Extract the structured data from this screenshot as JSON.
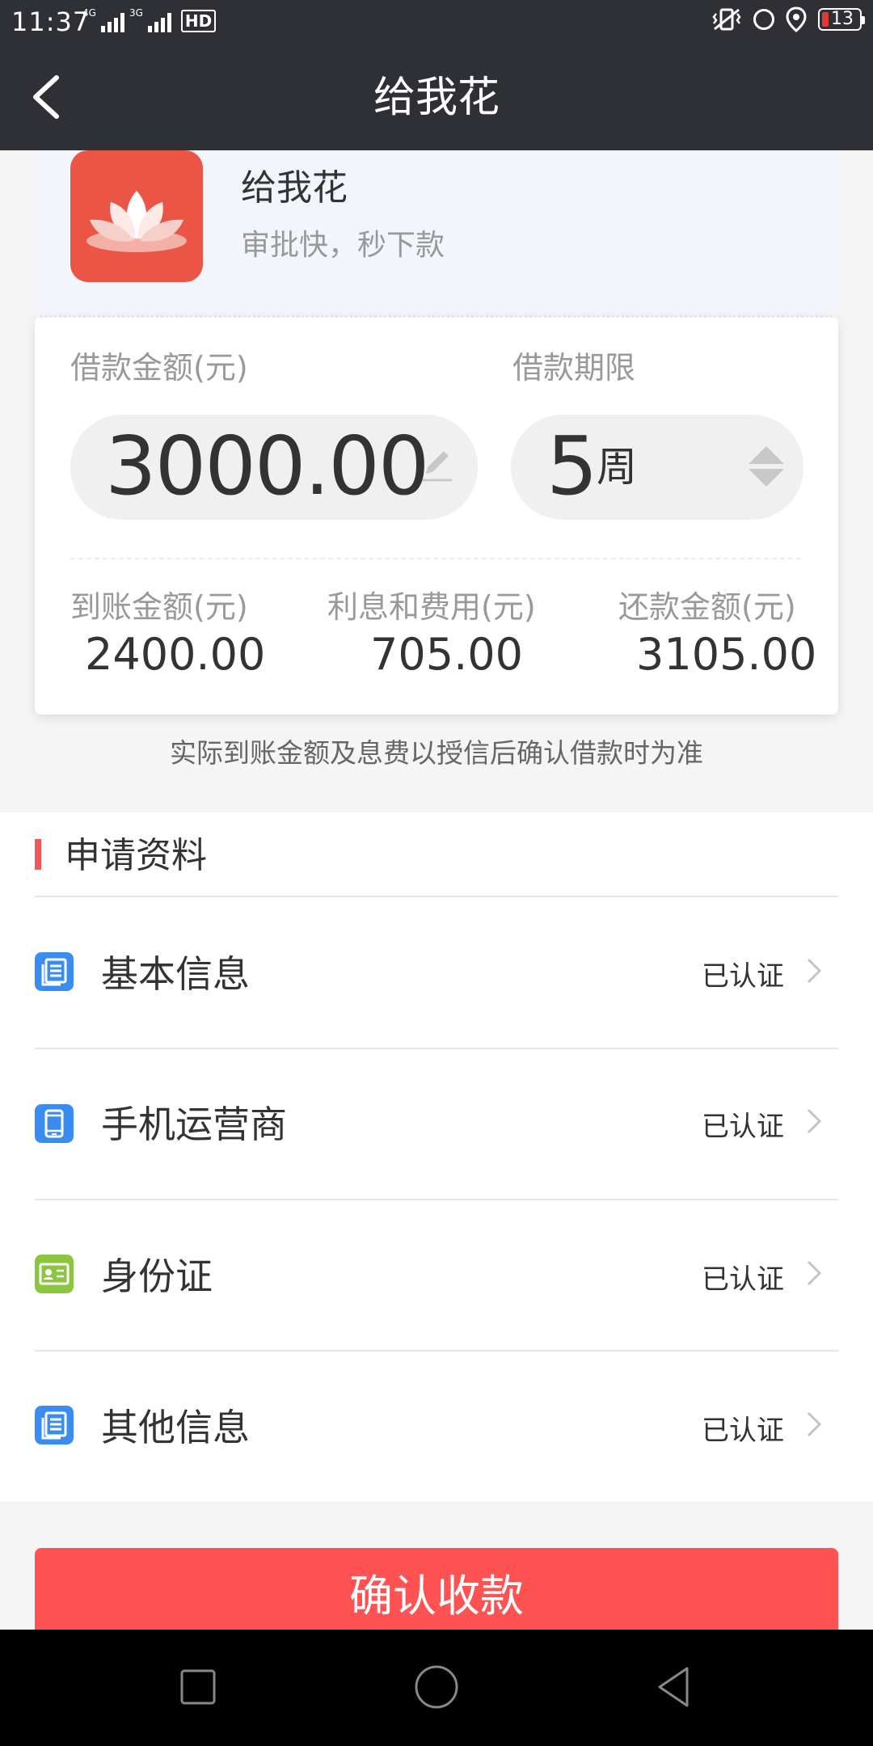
{
  "status_bar": {
    "time": "11:37",
    "net1": "4G",
    "net2": "3G",
    "hd": "HD",
    "battery": "13"
  },
  "header": {
    "title": "给我花"
  },
  "app": {
    "name": "给我花",
    "slogan": "审批快，秒下款"
  },
  "loan": {
    "amount_label": "借款金额(元)",
    "amount_value": "3000.00",
    "term_label": "借款期限",
    "term_number": "5",
    "term_unit": "周",
    "received_label": "到账金额(元)",
    "received_value": "2400.00",
    "fees_label": "利息和费用(元)",
    "fees_value": "705.00",
    "repay_label": "还款金额(元)",
    "repay_value": "3105.00",
    "notice": "实际到账金额及息费以授信后确认借款时为准"
  },
  "materials": {
    "title": "申请资料",
    "items": [
      {
        "label": "基本信息",
        "status": "已认证",
        "icon": "document-icon",
        "color": "#3b8cf0"
      },
      {
        "label": "手机运营商",
        "status": "已认证",
        "icon": "phone-icon",
        "color": "#3b8cf0"
      },
      {
        "label": "身份证",
        "status": "已认证",
        "icon": "id-card-icon",
        "color": "#8cc63f"
      },
      {
        "label": "其他信息",
        "status": "已认证",
        "icon": "document-icon",
        "color": "#3b8cf0"
      }
    ]
  },
  "confirm_button": "确认收款",
  "colors": {
    "header_bg": "#2e3035",
    "accent": "#ff5353",
    "logo_bg": "#ea5545"
  }
}
